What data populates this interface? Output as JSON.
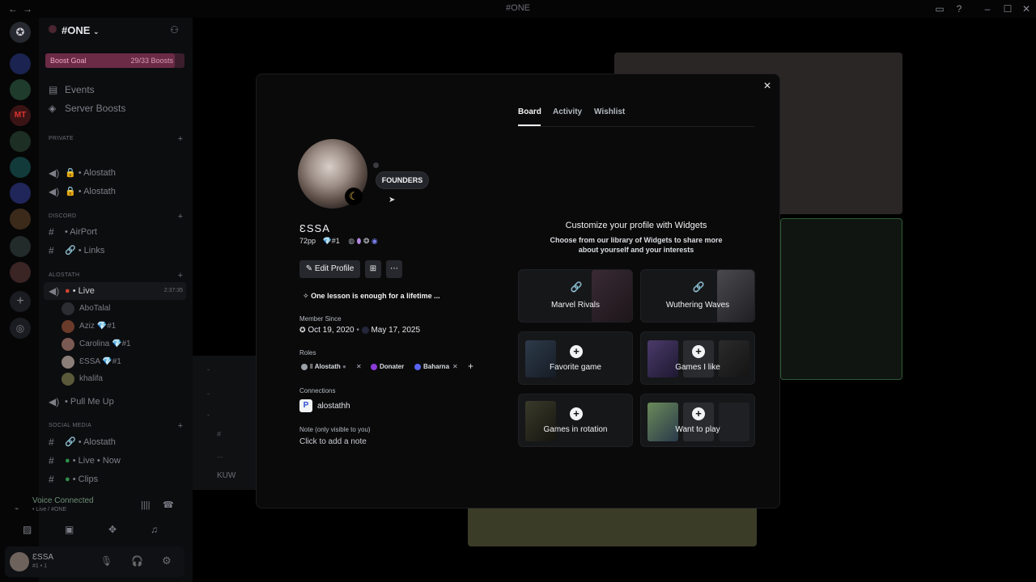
{
  "window": {
    "title": "#ONE"
  },
  "guild": {
    "name": "#ONE",
    "boost_goal_label": "Boost Goal",
    "boost_goal_count": "29/33 Boosts",
    "events": "Events",
    "server_boosts": "Server Boosts"
  },
  "categories": {
    "private": "PRIVATE",
    "discord": "DISCORD",
    "alostath": "ALOSTATH",
    "social": "SOCIAL MEDIA"
  },
  "channels": {
    "private_1": "Alostath",
    "private_2": "Alostath",
    "airport": "• AirPort",
    "links": "• Links",
    "live": "• Live",
    "live_time": "2:37:35",
    "pull": "• Pull Me Up",
    "social_1": "• Alostath",
    "social_2": "• Live • Now",
    "social_3": "• Clips"
  },
  "voice_users": [
    {
      "name": "AboTalal"
    },
    {
      "name": "Aziz 💎#1"
    },
    {
      "name": "Carolina 💎#1"
    },
    {
      "name": "ƐSSA 💎#1"
    },
    {
      "name": "khalifa"
    }
  ],
  "voice": {
    "status": "Voice Connected",
    "location": "• Live / #ONE"
  },
  "user_panel": {
    "name": "ƐSSA",
    "tag": "#1 • 1"
  },
  "mini_list": [
    "-",
    "-",
    "-",
    "#",
    "...",
    "KUW"
  ],
  "profile": {
    "founders_badge": "FOUNDERS",
    "display_name": "ƐSSA",
    "pronouns_line": "72pp",
    "tag": "💎#1",
    "edit_profile": "Edit Profile",
    "bio": "One lesson is enough for a lifetime ...",
    "member_since_label": "Member Since",
    "member_since_discord": "Oct 19, 2020",
    "member_since_server": "May 17, 2025",
    "roles_label": "Roles",
    "roles": [
      {
        "name": "Alostath",
        "color": "#9aa0a6"
      },
      {
        "name": "Donater",
        "color": "#8a3bd9"
      },
      {
        "name": "Baharna",
        "color": "#5865f2"
      }
    ],
    "connections_label": "Connections",
    "connection_name": "alostathh",
    "note_label": "Note (only visible to you)",
    "note_placeholder": "Click to add a note"
  },
  "tabs": [
    {
      "label": "Board"
    },
    {
      "label": "Activity"
    },
    {
      "label": "Wishlist"
    }
  ],
  "widgets": {
    "heading": "Customize your profile with Widgets",
    "subheading_1": "Choose from our library of Widgets to share more",
    "subheading_2": "about yourself and your interests",
    "cards": [
      {
        "label": "Marvel Rivals",
        "icon": "link-icon"
      },
      {
        "label": "Wuthering Waves",
        "icon": "link-icon"
      },
      {
        "label": "Favorite game",
        "icon": "plus-icon"
      },
      {
        "label": "Games I like",
        "icon": "plus-icon"
      },
      {
        "label": "Games in rotation",
        "icon": "plus-icon"
      },
      {
        "label": "Want to play",
        "icon": "plus-icon"
      }
    ]
  },
  "colors": {
    "accent": "#5865f2",
    "boost": "#e2367a"
  }
}
